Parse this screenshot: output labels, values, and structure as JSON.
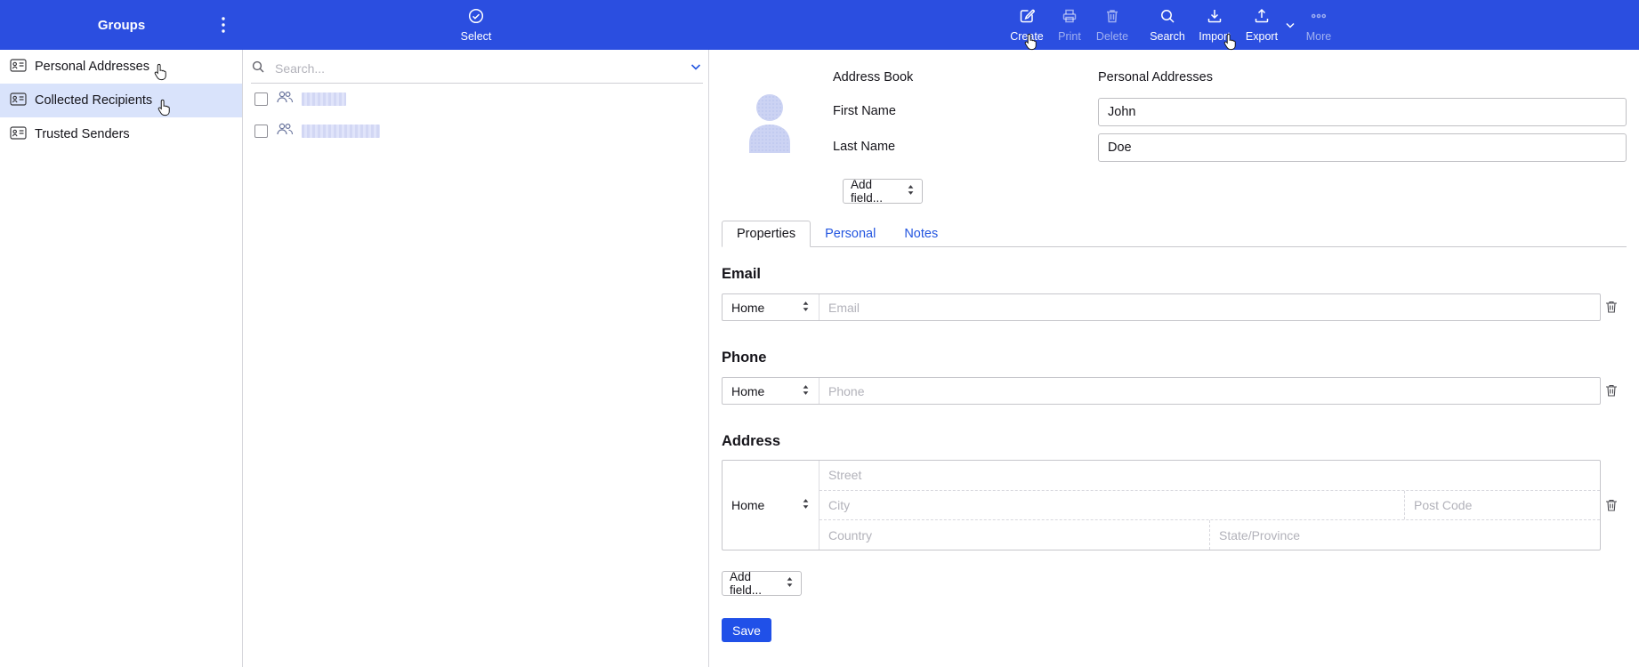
{
  "colors": {
    "topbar_bg": "#2b4ee0",
    "accent_blue": "#2456e0",
    "save_button_bg": "#2050e8",
    "selected_item_bg": "#d9e3fb",
    "redacted_block": "#d8dcf6"
  },
  "topbar": {
    "groups_label": "Groups",
    "select_label": "Select",
    "buttons": [
      {
        "label": "Create",
        "state": "enabled"
      },
      {
        "label": "Print",
        "state": "disabled"
      },
      {
        "label": "Delete",
        "state": "disabled"
      },
      {
        "label": "Search",
        "state": "enabled"
      },
      {
        "label": "Import",
        "state": "enabled"
      },
      {
        "label": "Export",
        "state": "enabled"
      },
      {
        "label": "More",
        "state": "disabled"
      }
    ]
  },
  "sidebar": {
    "items": [
      {
        "label": "Personal Addresses",
        "selected": false
      },
      {
        "label": "Collected Recipients",
        "selected": true
      },
      {
        "label": "Trusted Senders",
        "selected": false
      }
    ]
  },
  "list": {
    "search_placeholder": "Search..."
  },
  "form": {
    "header": {
      "address_book_label": "Address Book",
      "address_book_value": "Personal Addresses",
      "first_name_label": "First Name",
      "first_name_value": "John",
      "last_name_label": "Last Name",
      "last_name_value": "Doe",
      "add_field_label": "Add field..."
    },
    "tabs": [
      {
        "label": "Properties",
        "active": true
      },
      {
        "label": "Personal",
        "active": false
      },
      {
        "label": "Notes",
        "active": false
      }
    ],
    "email": {
      "heading": "Email",
      "type_value": "Home",
      "placeholder": "Email"
    },
    "phone": {
      "heading": "Phone",
      "type_value": "Home",
      "placeholder": "Phone"
    },
    "address": {
      "heading": "Address",
      "type_value": "Home",
      "street_placeholder": "Street",
      "city_placeholder": "City",
      "post_code_placeholder": "Post Code",
      "country_placeholder": "Country",
      "state_placeholder": "State/Province"
    },
    "add_field_label": "Add field...",
    "save_label": "Save"
  }
}
